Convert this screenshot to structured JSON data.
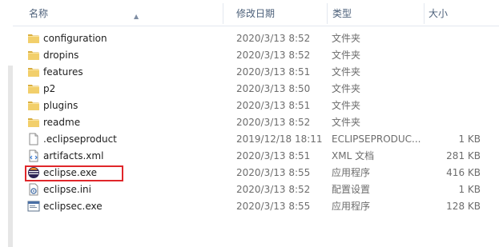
{
  "columns": {
    "name": "名称",
    "date": "修改日期",
    "type": "类型",
    "size": "大小"
  },
  "files": [
    {
      "name": "configuration",
      "date": "2020/3/13 8:52",
      "type": "文件夹",
      "size": "",
      "icon": "folder-icon"
    },
    {
      "name": "dropins",
      "date": "2020/3/13 8:52",
      "type": "文件夹",
      "size": "",
      "icon": "folder-icon"
    },
    {
      "name": "features",
      "date": "2020/3/13 8:51",
      "type": "文件夹",
      "size": "",
      "icon": "folder-icon"
    },
    {
      "name": "p2",
      "date": "2020/3/13 8:50",
      "type": "文件夹",
      "size": "",
      "icon": "folder-icon"
    },
    {
      "name": "plugins",
      "date": "2020/3/13 8:51",
      "type": "文件夹",
      "size": "",
      "icon": "folder-icon"
    },
    {
      "name": "readme",
      "date": "2020/3/13 8:52",
      "type": "文件夹",
      "size": "",
      "icon": "folder-icon"
    },
    {
      "name": ".eclipseproduct",
      "date": "2019/12/18 18:11",
      "type": "ECLIPSEPRODUC...",
      "size": "1 KB",
      "icon": "file-icon"
    },
    {
      "name": "artifacts.xml",
      "date": "2020/3/13 8:51",
      "type": "XML 文档",
      "size": "281 KB",
      "icon": "xml-file-icon"
    },
    {
      "name": "eclipse.exe",
      "date": "2020/3/13 8:55",
      "type": "应用程序",
      "size": "416 KB",
      "icon": "eclipse-icon"
    },
    {
      "name": "eclipse.ini",
      "date": "2020/3/13 8:52",
      "type": "配置设置",
      "size": "1 KB",
      "icon": "settings-file-icon"
    },
    {
      "name": "eclipsec.exe",
      "date": "2020/3/13 8:55",
      "type": "应用程序",
      "size": "128 KB",
      "icon": "exe-window-icon"
    }
  ],
  "highlighted_file": "eclipse.exe",
  "colors": {
    "highlight_border": "#e0262a",
    "folder": "#e8c35a",
    "header_text": "#4c607a"
  }
}
